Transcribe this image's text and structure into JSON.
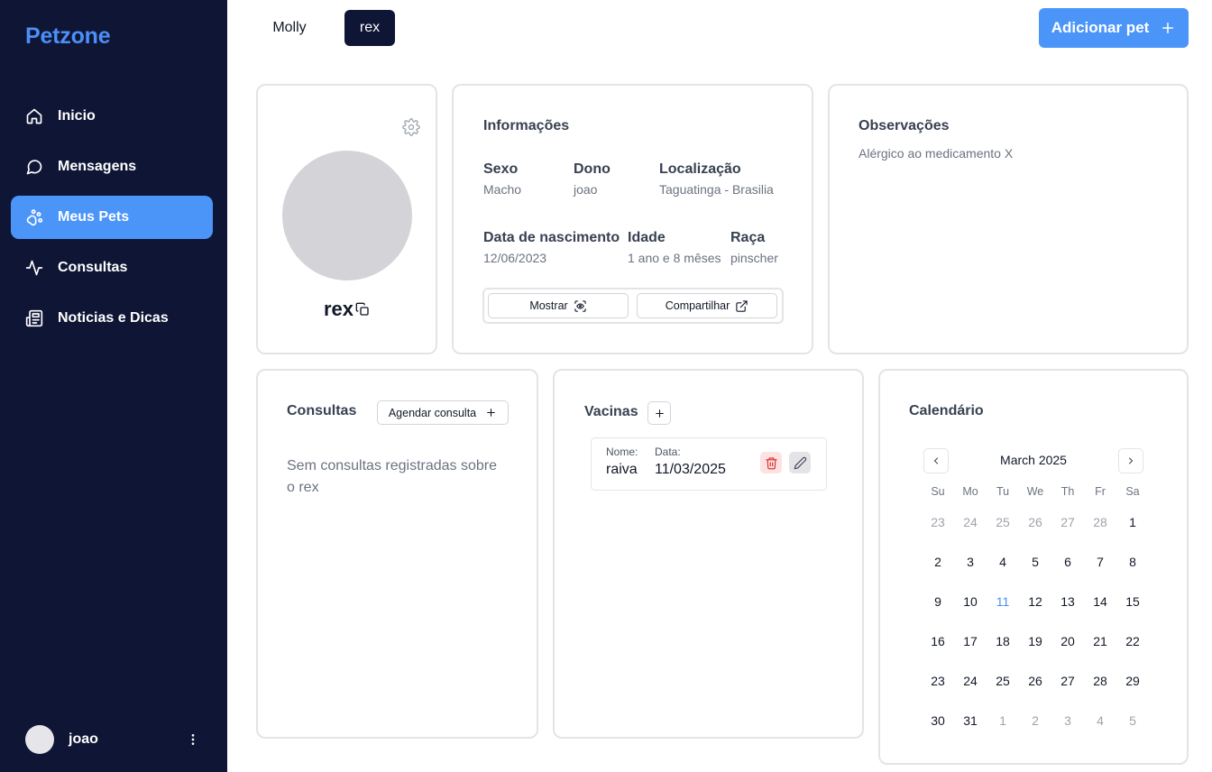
{
  "app": {
    "brand": "Petzone"
  },
  "sidebar": {
    "items": [
      {
        "label": "Inicio",
        "icon": "home-icon"
      },
      {
        "label": "Mensagens",
        "icon": "message-circle-icon"
      },
      {
        "label": "Meus Pets",
        "icon": "paw-icon",
        "active": true
      },
      {
        "label": "Consultas",
        "icon": "activity-icon"
      },
      {
        "label": "Noticias e Dicas",
        "icon": "newspaper-icon"
      }
    ],
    "user": {
      "name": "joao"
    }
  },
  "pet_tabs": [
    {
      "label": "Molly",
      "active": false
    },
    {
      "label": "rex",
      "active": true
    }
  ],
  "header": {
    "add_pet_label": "Adicionar pet"
  },
  "profile": {
    "name": "rex"
  },
  "info": {
    "title": "Informações",
    "fields": {
      "sexo": {
        "label": "Sexo",
        "value": "Macho"
      },
      "dono": {
        "label": "Dono",
        "value": "joao"
      },
      "localizacao": {
        "label": "Localização",
        "value": "Taguatinga - Brasilia"
      },
      "nascimento": {
        "label": "Data de nascimento",
        "value": "12/06/2023"
      },
      "idade": {
        "label": "Idade",
        "value": "1 ano e 8 mêses"
      },
      "raca": {
        "label": "Raça",
        "value": "pinscher"
      }
    },
    "show_label": "Mostrar",
    "share_label": "Compartilhar"
  },
  "observacoes": {
    "title": "Observações",
    "text": "Alérgico ao medicamento X"
  },
  "consultas": {
    "title": "Consultas",
    "schedule_label": "Agendar consulta",
    "empty_text": "Sem consultas registradas sobre o rex"
  },
  "vacinas": {
    "title": "Vacinas",
    "items": [
      {
        "name_label": "Nome:",
        "name": "raiva",
        "date_label": "Data:",
        "date": "11/03/2025"
      }
    ]
  },
  "calendario": {
    "title": "Calendário",
    "month": "March 2025",
    "weekdays": [
      "Su",
      "Mo",
      "Tu",
      "We",
      "Th",
      "Fr",
      "Sa"
    ],
    "weeks": [
      [
        "23",
        "24",
        "25",
        "26",
        "27",
        "28",
        "1"
      ],
      [
        "2",
        "3",
        "4",
        "5",
        "6",
        "7",
        "8"
      ],
      [
        "9",
        "10",
        "11",
        "12",
        "13",
        "14",
        "15"
      ],
      [
        "16",
        "17",
        "18",
        "19",
        "20",
        "21",
        "22"
      ],
      [
        "23",
        "24",
        "25",
        "26",
        "27",
        "28",
        "29"
      ],
      [
        "30",
        "31",
        "1",
        "2",
        "3",
        "4",
        "5"
      ]
    ],
    "today": "11",
    "colors": {
      "today": "#4b8ff7",
      "muted": "#a1a1aa"
    }
  },
  "colors": {
    "sidebar_bg": "#0f1535",
    "accent": "#4b95f9",
    "brand": "#4b8ff7"
  }
}
